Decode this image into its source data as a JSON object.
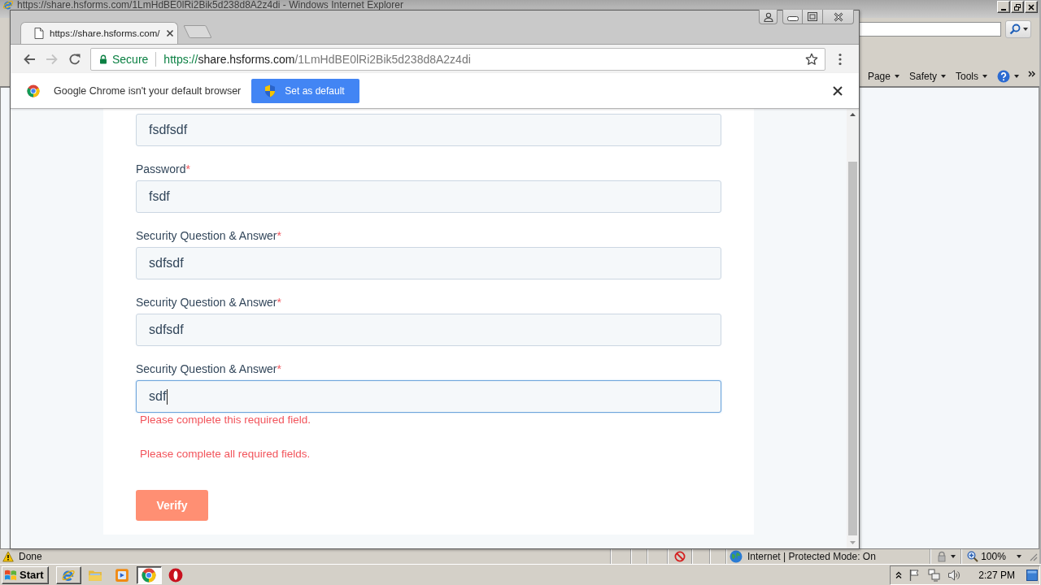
{
  "ie_window": {
    "title": "https://share.hsforms.com/1LmHdBE0lRi2Bik5d238d8A2z4di - Windows Internet Explorer",
    "command_bar": [
      {
        "label": "Page"
      },
      {
        "label": "Safety"
      },
      {
        "label": "Tools"
      }
    ],
    "status_bar": {
      "status": "Done",
      "zone": "Internet | Protected Mode: On",
      "zoom": "100%"
    }
  },
  "browser": {
    "tab": {
      "title": "https://share.hsforms.com/"
    },
    "address": {
      "security": "Secure",
      "scheme": "https://",
      "host": "share.hsforms.com",
      "path": "/1LmHdBE0lRi2Bik5d238d8A2z4di"
    },
    "infobar": {
      "message": "Google Chrome isn't your default browser",
      "button": "Set as default"
    }
  },
  "form": {
    "fields": [
      {
        "value": "fsdfsdf",
        "focused": false
      },
      {
        "label": "Password",
        "mark": "*",
        "value": "fsdf",
        "focused": false
      },
      {
        "label": "Security Question & Answer",
        "mark": "*",
        "value": "sdfsdf",
        "focused": false
      },
      {
        "label": "Security Question & Answer",
        "mark": "*",
        "value": "sdfsdf",
        "focused": false
      },
      {
        "label": "Security Question & Answer",
        "mark": "*",
        "value": "sdf",
        "focused": true,
        "error": "Please complete this required field."
      }
    ],
    "form_error": "Please complete all required fields.",
    "submit": "Verify"
  },
  "taskbar": {
    "start": "Start",
    "buttons": [
      {
        "kind": "e-logo",
        "open": true,
        "selected": false
      },
      {
        "kind": "folder",
        "open": false,
        "selected": false
      },
      {
        "kind": "player",
        "open": false,
        "selected": false
      },
      {
        "kind": "round-logo",
        "open": true,
        "selected": true
      },
      {
        "kind": "ring-logo",
        "open": false,
        "selected": false
      }
    ],
    "clock": "2:27 PM"
  }
}
